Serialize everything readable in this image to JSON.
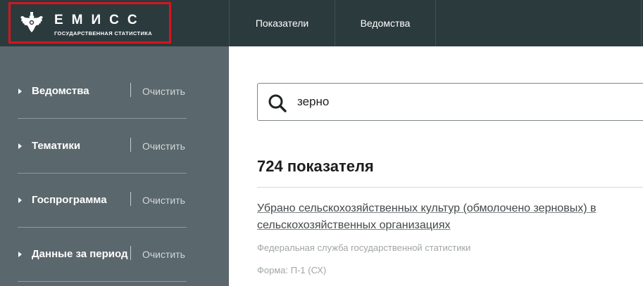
{
  "header": {
    "logo_title": "ЕМИСС",
    "logo_subtitle": "ГОСУДАРСТВЕННАЯ СТАТИСТИКА",
    "nav": [
      "Показатели",
      "Ведомства"
    ]
  },
  "sidebar": {
    "filters": [
      {
        "label": "Ведомства",
        "clear": "Очистить"
      },
      {
        "label": "Тематики",
        "clear": "Очистить"
      },
      {
        "label": "Госпрограмма",
        "clear": "Очистить"
      },
      {
        "label": "Данные за период",
        "clear": "Очистить"
      }
    ]
  },
  "search": {
    "value": "зерно"
  },
  "results": {
    "count_text": "724 показателя",
    "items": [
      {
        "title": "Убрано сельскохозяйственных культур (обмолочено зерновых) в сельскохозяйственных организациях",
        "agency": "Федеральная служба государственной статистики",
        "form": "Форма: П-1 (СХ)"
      }
    ]
  },
  "colors": {
    "header_bg": "#2b3a3d",
    "sidebar_bg": "#5a676c",
    "logo_border": "#d9141e"
  }
}
